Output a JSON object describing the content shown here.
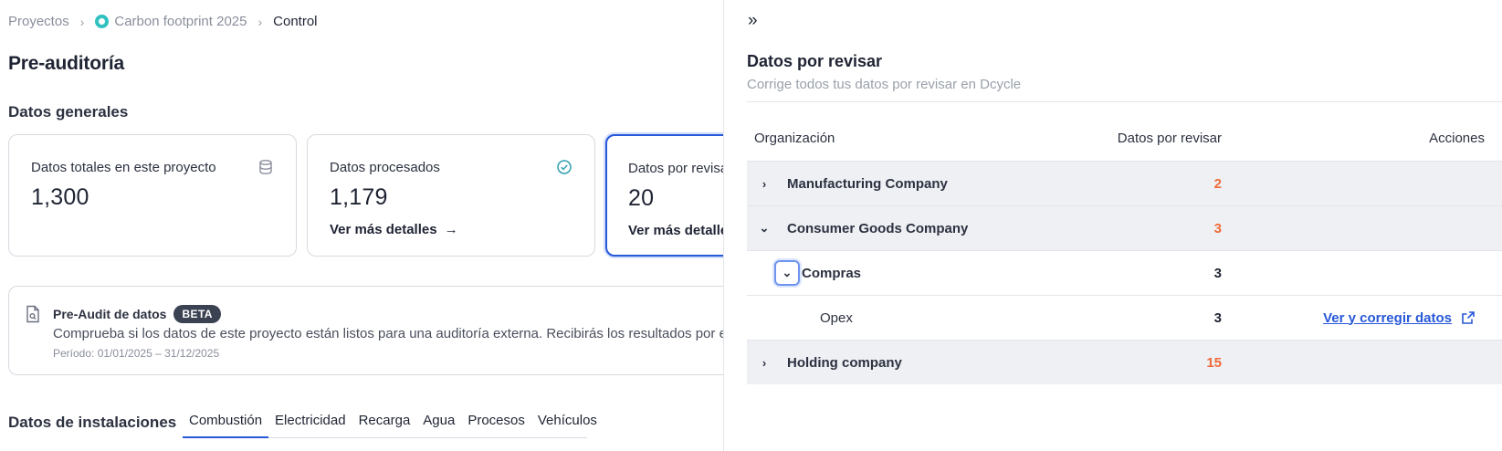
{
  "breadcrumb": {
    "items": [
      "Proyectos",
      "Carbon footprint 2025",
      "Control"
    ]
  },
  "page": {
    "title": "Pre-auditoría",
    "general_section": "Datos generales"
  },
  "cards": [
    {
      "label": "Datos totales en este proyecto",
      "value": "1,300",
      "icon": "database-icon"
    },
    {
      "label": "Datos procesados",
      "value": "1,179",
      "link": "Ver más detalles",
      "icon": "check-circle-icon"
    },
    {
      "label": "Datos por revisar",
      "value": "20",
      "link": "Ver más detalles"
    }
  ],
  "preaudit": {
    "title": "Pre-Audit de datos",
    "badge": "BETA",
    "description": "Comprueba si los datos de este proyecto están listos para una auditoría externa. Recibirás los resultados por email",
    "period": "Período: 01/01/2025 – 31/12/2025"
  },
  "installations": {
    "title": "Datos de instalaciones",
    "tabs": [
      "Combustión",
      "Electricidad",
      "Recarga",
      "Agua",
      "Procesos",
      "Vehículos"
    ],
    "active_tab": 0
  },
  "panel": {
    "collapse_glyph": "»",
    "title": "Datos por revisar",
    "subtitle": "Corrige todos tus datos por revisar en Dcycle",
    "columns": [
      "Organización",
      "Datos por revisar",
      "Acciones"
    ],
    "rows": [
      {
        "name": "Manufacturing Company",
        "count": "2",
        "expanded": false
      },
      {
        "name": "Consumer Goods Company",
        "count": "3",
        "expanded": true
      },
      {
        "name": "Compras",
        "count": "3",
        "expanded": true
      },
      {
        "name": "Opex",
        "count": "3",
        "action": "Ver y corregir datos"
      },
      {
        "name": "Holding company",
        "count": "15",
        "expanded": false
      }
    ]
  },
  "colors": {
    "accent": "#2758d8",
    "warning": "#f06a38",
    "teal": "#2fc0c0"
  }
}
